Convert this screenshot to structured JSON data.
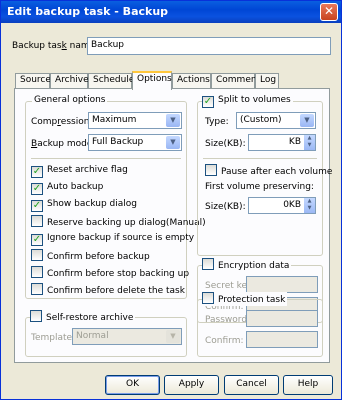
{
  "window": {
    "title": "Edit backup task - Backup",
    "close_glyph": "✕"
  },
  "task_name": {
    "label_pre": "Backup tas",
    "label_u": "k",
    "label_post": " name:",
    "value": "Backup"
  },
  "tabs": [
    "Source",
    "Archive",
    "Schedule",
    "Options",
    "Actions",
    "Comment",
    "Log"
  ],
  "active_tab": "Options",
  "general": {
    "title": "General options",
    "compression_label_pre": "Comp",
    "compression_label_u": "r",
    "compression_label_post": "ession:",
    "compression_value": "Maximum",
    "mode_label_u": "B",
    "mode_label_post": "ackup mode:",
    "mode_value": "Full Backup",
    "check_glyph": "✓",
    "checks": [
      {
        "label": "Reset archive flag",
        "checked": true
      },
      {
        "label": "Auto backup",
        "checked": true
      },
      {
        "label": "Show backup dialog",
        "checked": true
      },
      {
        "label": "Reserve backing up dialog(Manual)",
        "checked": false
      },
      {
        "label": "Ignore backup if source is empty",
        "checked": true
      },
      {
        "label": "Confirm before backup",
        "checked": false
      },
      {
        "label": "Confirm before stop backing up",
        "checked": false
      },
      {
        "label": "Confirm before delete the task",
        "checked": false
      }
    ]
  },
  "self_restore": {
    "title": "Self-restore archive",
    "template_label": "Template:",
    "template_value": "Normal"
  },
  "split": {
    "title": "Split to volumes",
    "type_label": "Type:",
    "type_value": "(Custom)",
    "size_label": "Size(KB):",
    "size_value": "KB",
    "pause_label": "Pause after each volume",
    "first_volume_label": "First volume preserving:",
    "size2_label": "Size(KB):",
    "size2_value": "0KB"
  },
  "encryption": {
    "title": "Encryption data",
    "secret_label": "Secret key:",
    "confirm_label": "Confirm:"
  },
  "protection": {
    "title": "Protection task",
    "password_label": "Password:",
    "confirm_label": "Confirm:"
  },
  "buttons": {
    "ok": "OK",
    "apply": "Apply",
    "cancel": "Cancel",
    "help": "Help"
  }
}
